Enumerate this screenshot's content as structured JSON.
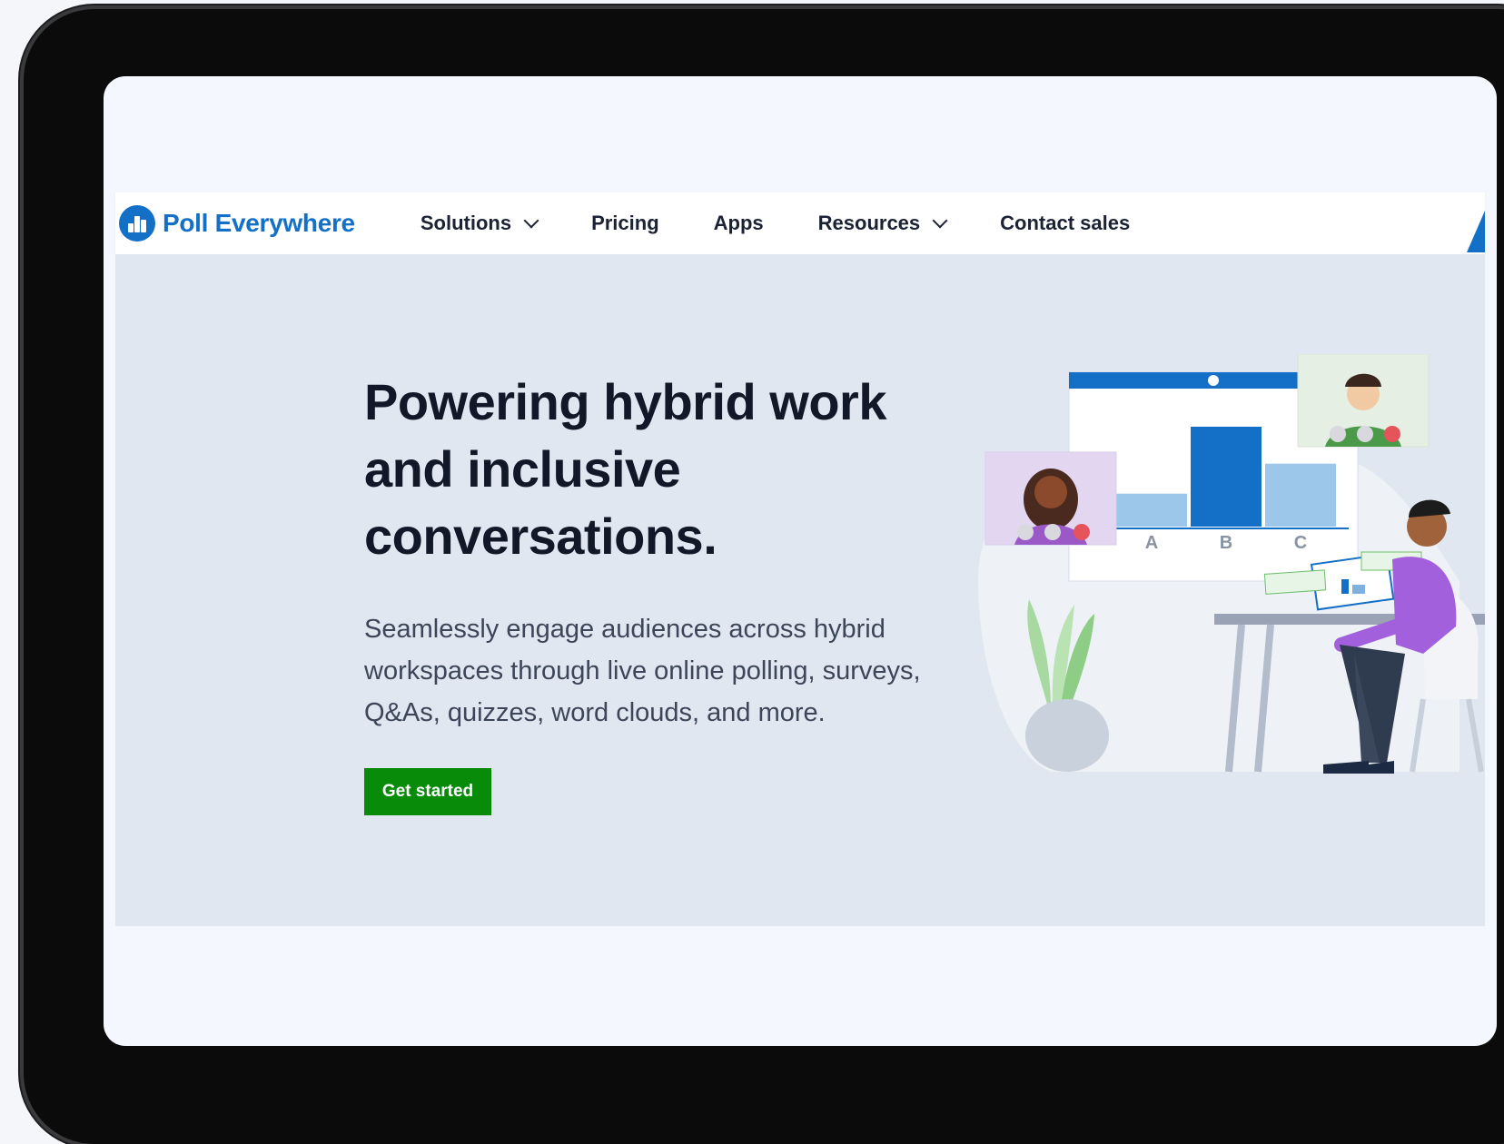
{
  "brand": {
    "name": "Poll Everywhere",
    "color": "#1470c6"
  },
  "nav": {
    "items": [
      {
        "label": "Solutions",
        "dropdown": true
      },
      {
        "label": "Pricing",
        "dropdown": false
      },
      {
        "label": "Apps",
        "dropdown": false
      },
      {
        "label": "Resources",
        "dropdown": true
      },
      {
        "label": "Contact sales",
        "dropdown": false
      }
    ]
  },
  "hero": {
    "title": "Powering hybrid work and inclusive conversations.",
    "subtitle": "Seamlessly engage audiences across hybrid workspaces through live online polling, surveys, Q&As, quizzes, word clouds, and more.",
    "cta_label": "Get started",
    "cta_color": "#078b09"
  },
  "illustration": {
    "poll_options": [
      "A",
      "B",
      "C"
    ],
    "poll_levels": [
      0.33,
      1.0,
      0.63
    ],
    "icons": [
      "video-call-participant-woman",
      "video-call-participant-man",
      "seated-presenter",
      "laptop",
      "plant"
    ]
  }
}
